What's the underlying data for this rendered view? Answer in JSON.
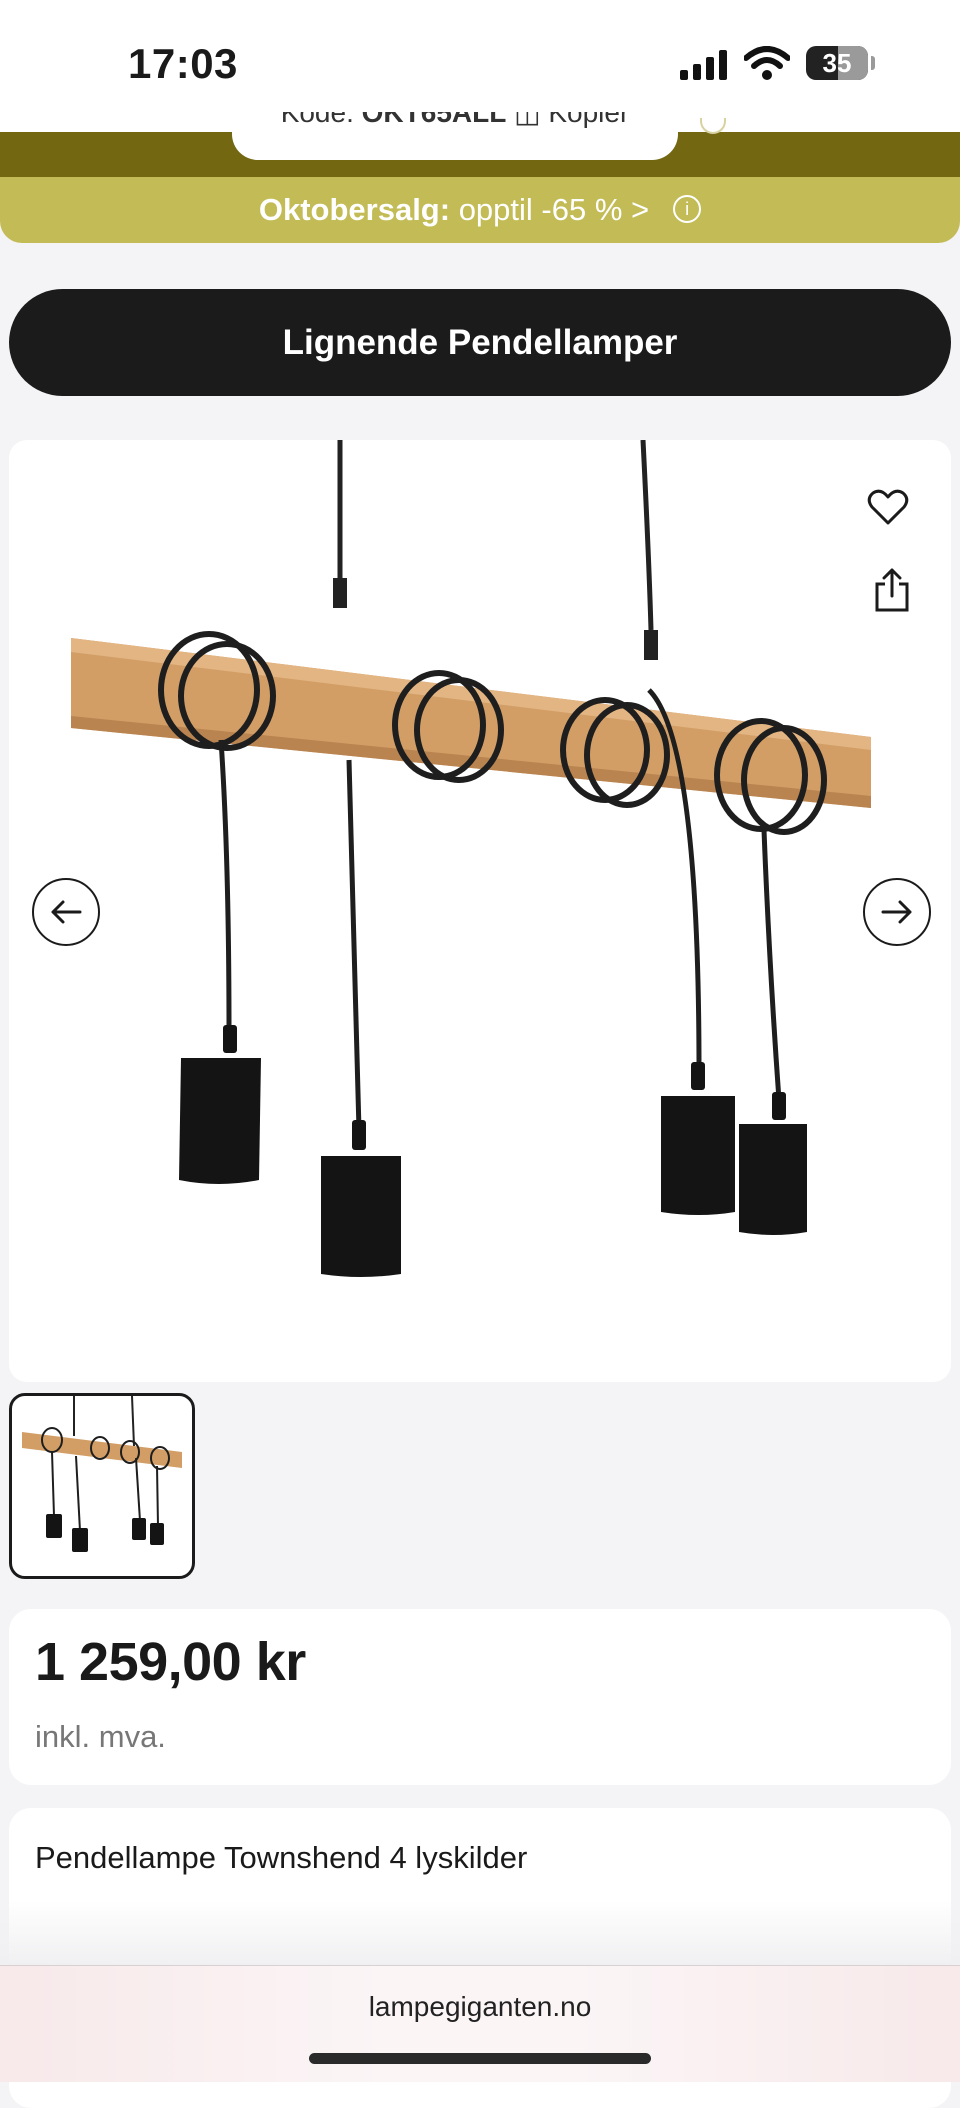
{
  "status_bar": {
    "time": "17:03",
    "battery": "35"
  },
  "promo": {
    "code_label": "Kode:",
    "code_value": "OKT65ALL",
    "copy_label": "Kopier",
    "banner_bold": "Oktobersalg:",
    "banner_text": " opptil -65 % >",
    "info_symbol": "i"
  },
  "similar_button": {
    "label": "Lignende Pendellamper"
  },
  "gallery": {
    "favorite_icon": "heart-icon",
    "share_icon": "share-icon",
    "prev_icon": "arrow-left-icon",
    "next_icon": "arrow-right-icon",
    "thumbnail_count": 1
  },
  "price": {
    "amount": "1 259,00 kr",
    "vat_note": "inkl. mva."
  },
  "product": {
    "title": "Pendellampe Townshend 4 lyskilder"
  },
  "browser": {
    "url": "lampegiganten.no"
  },
  "colors": {
    "banner_dark": "#736712",
    "banner_light": "#c2bb56",
    "button_dark": "#1b1b1b",
    "wood": "#cf9a63"
  }
}
